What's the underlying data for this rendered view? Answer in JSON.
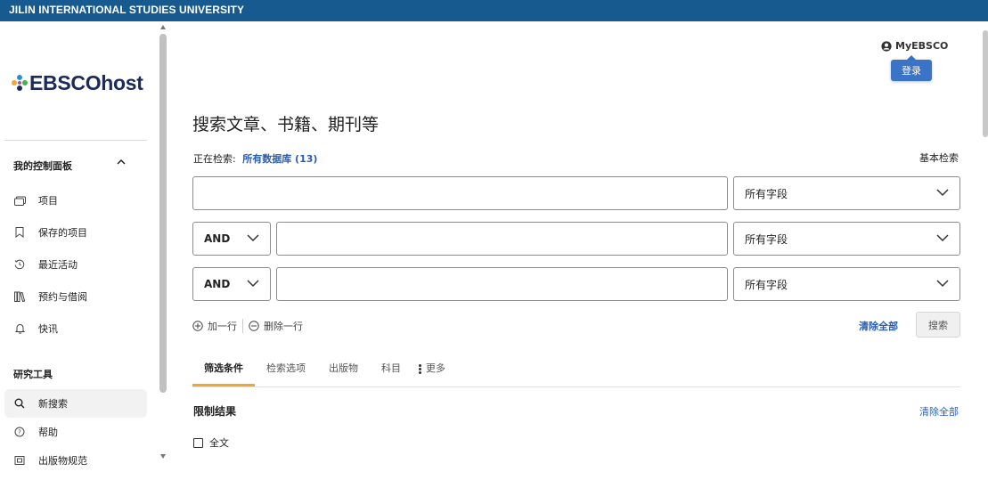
{
  "header": {
    "institution": "JILIN INTERNATIONAL STUDIES UNIVERSITY"
  },
  "brand": {
    "logo_text": "EBSCOhost"
  },
  "sidebar": {
    "dashboard_heading": "我的控制面板",
    "dashboard_items": [
      {
        "label": "项目",
        "icon": "folder-icon"
      },
      {
        "label": "保存的项目",
        "icon": "bookmark-icon"
      },
      {
        "label": "最近活动",
        "icon": "history-icon"
      },
      {
        "label": "预约与借阅",
        "icon": "books-icon"
      },
      {
        "label": "快讯",
        "icon": "bell-icon"
      }
    ],
    "tools_heading": "研究工具",
    "tools_items": [
      {
        "label": "新搜索",
        "icon": "search-icon",
        "active": true
      },
      {
        "label": "帮助",
        "icon": "help-icon"
      },
      {
        "label": "出版物规范",
        "icon": "publication-icon"
      }
    ]
  },
  "account": {
    "myebsco_label": "MyEBSCO",
    "login_label": "登录"
  },
  "search": {
    "title": "搜索文章、书籍、期刊等",
    "searching_label": "正在检索:",
    "database_link": "所有数据库 (13)",
    "basic_search_link": "基本检索",
    "rows": [
      {
        "query": "",
        "field": "所有字段"
      },
      {
        "operator": "AND",
        "query": "",
        "field": "所有字段"
      },
      {
        "operator": "AND",
        "query": "",
        "field": "所有字段"
      }
    ],
    "add_row_label": "加一行",
    "delete_row_label": "删除一行",
    "clear_all_label": "清除全部",
    "search_button_label": "搜索"
  },
  "tabs": [
    {
      "label": "筛选条件",
      "active": true
    },
    {
      "label": "检索选项"
    },
    {
      "label": "出版物"
    },
    {
      "label": "科目"
    },
    {
      "label": "更多"
    }
  ],
  "filters": {
    "limit_title": "限制结果",
    "clear_all_label": "清除全部",
    "fulltext_label": "全文",
    "fulltext_checked": false
  },
  "colors": {
    "topbar": "#175a8f",
    "accent": "#f0a830",
    "link": "#2a5db0",
    "login": "#3b73c7"
  }
}
